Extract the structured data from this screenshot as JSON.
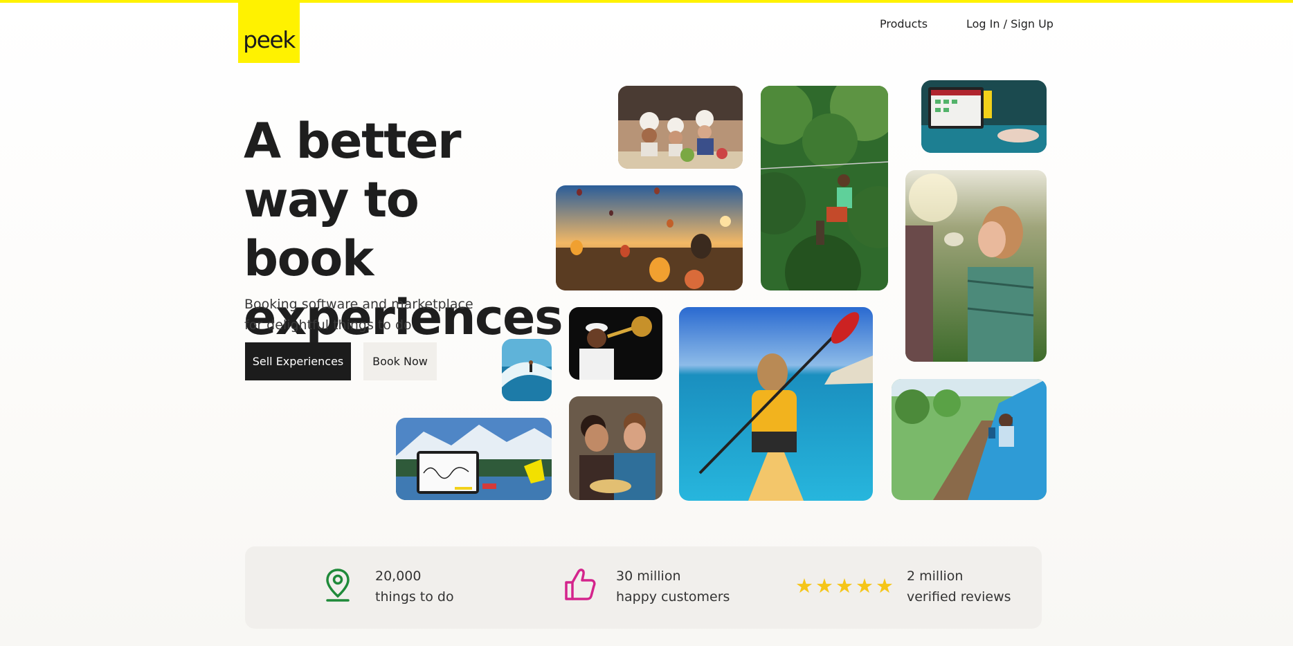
{
  "brand": {
    "logo_text": "peek",
    "accent": "#fff200"
  },
  "nav": {
    "products": "Products",
    "login": "Log In / Sign Up"
  },
  "hero": {
    "headline_lines": [
      "A better",
      "way to book",
      "experiences"
    ],
    "subtitle_lines": [
      "Booking software and marketplace",
      "for delightful things to do"
    ],
    "sell_button": "Sell Experiences",
    "book_button": "Book Now"
  },
  "gallery": [
    "kids-cooking-photo",
    "zipline-photo",
    "tablet-cliff-photo",
    "hot-air-balloons-photo",
    "wine-tasting-photo",
    "trombone-player-photo",
    "kayak-photo",
    "surfer-photo",
    "train-photo",
    "tablet-signature-photo",
    "noodles-friends-photo"
  ],
  "stats": [
    {
      "icon": "location-pin-icon",
      "color": "#1f8a3a",
      "line1": "20,000",
      "line2": "things to do"
    },
    {
      "icon": "thumbs-up-icon",
      "color": "#d4248c",
      "line1": "30 million",
      "line2": "happy customers"
    },
    {
      "icon": "five-stars-icon",
      "color": "#f5c518",
      "line1": "2 million",
      "line2": "verified reviews"
    }
  ]
}
